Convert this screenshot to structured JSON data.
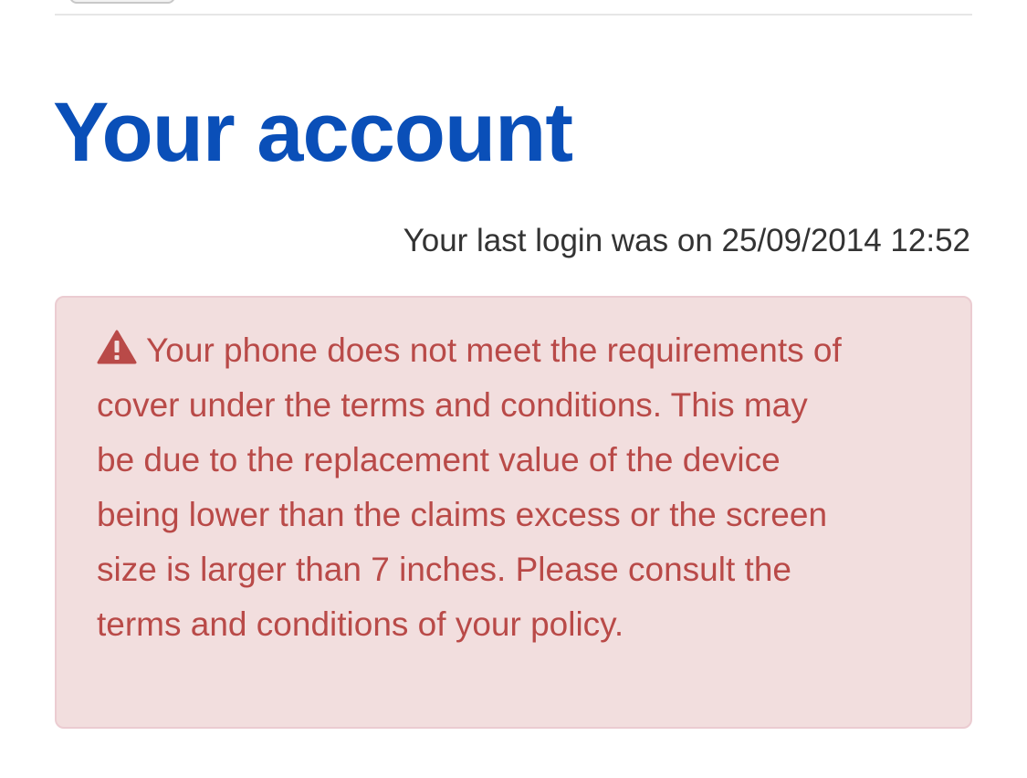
{
  "header": {
    "title": "Your account",
    "last_login": "Your last login was on 25/09/2014 12:52"
  },
  "alert": {
    "icon": "warning-triangle-icon",
    "message": "Your phone does not meet the requirements of cover under the terms and conditions. This may be due to the replacement value of the device being lower than the claims excess or the screen size is larger than 7 inches. Please consult the terms and conditions of your policy.",
    "colors": {
      "text": "#b94a48",
      "background": "#f2dede",
      "border": "#ebccd1"
    }
  },
  "colors": {
    "title": "#0a4fb8"
  }
}
